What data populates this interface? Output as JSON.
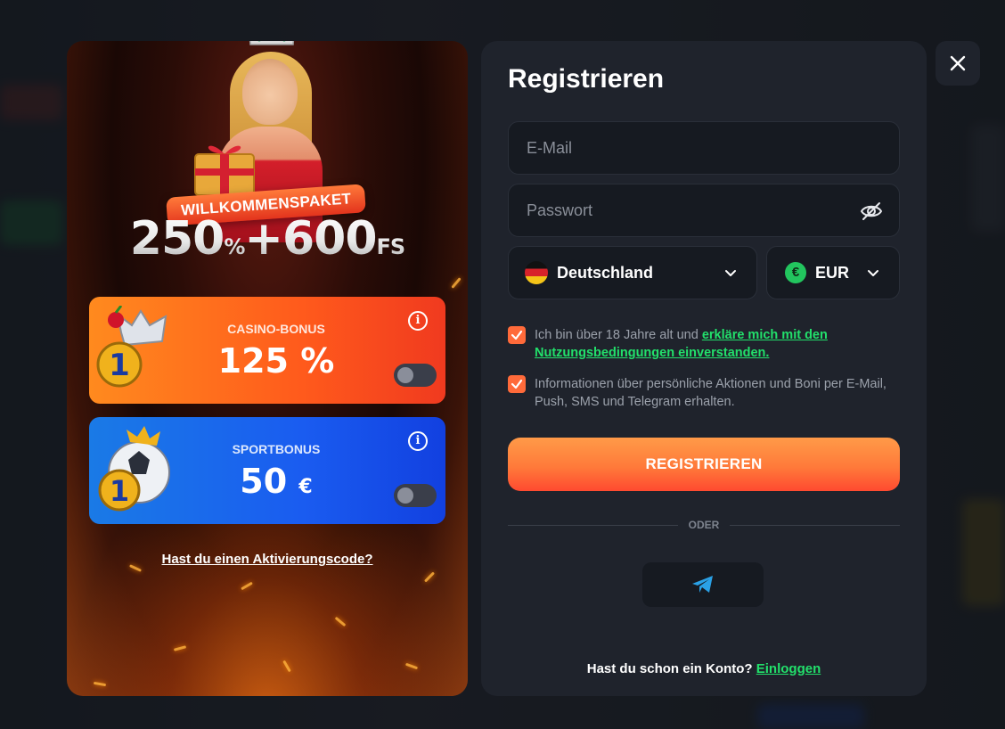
{
  "promo": {
    "badge": "WILLKOMMENSPAKET",
    "headline": {
      "part1": "250",
      "part1_unit": "%",
      "plus": "+",
      "part2": "600",
      "part2_unit": "FS"
    },
    "casino": {
      "title": "CASINO-BONUS",
      "value": "125",
      "unit": "%",
      "toggle_on": false
    },
    "sport": {
      "title": "SPORTBONUS",
      "value": "50",
      "unit": "€",
      "toggle_on": false
    },
    "activation_link": "Hast du einen Aktivierungscode?"
  },
  "form": {
    "title": "Registrieren",
    "email_placeholder": "E-Mail",
    "password_placeholder": "Passwort",
    "country": "Deutschland",
    "currency": "EUR",
    "currency_symbol": "€",
    "terms": {
      "text": "Ich bin über 18 Jahre alt und ",
      "link": "erkläre mich mit den Nutzungsbedingungen einverstanden.",
      "checked": true
    },
    "promo_consent": {
      "text": "Informationen über persönliche Aktionen und Boni per E-Mail, Push, SMS und Telegram erhalten.",
      "checked": true
    },
    "submit": "REGISTRIEREN",
    "divider": "ODER",
    "login_prompt": "Hast du schon ein Konto?",
    "login_link": "Einloggen"
  },
  "colors": {
    "accent_orange": "#ff7a3a",
    "link_green": "#22e06b",
    "panel_bg": "#1f232c",
    "field_bg": "#161a21"
  },
  "icons": [
    "close-icon",
    "eye-off-icon",
    "chevron-down-icon",
    "euro-icon",
    "telegram-icon",
    "info-icon",
    "germany-flag-icon"
  ]
}
